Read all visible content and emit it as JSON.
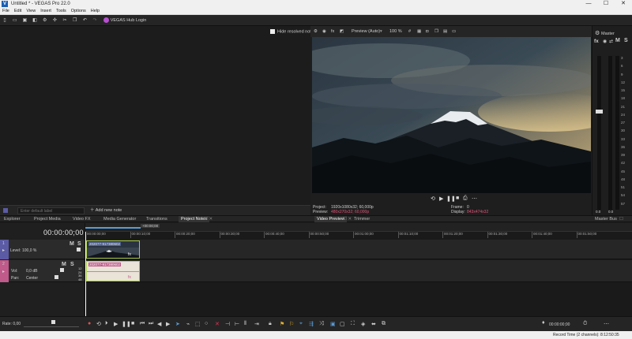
{
  "window": {
    "title": "Untitled * - VEGAS Pro 22.0",
    "app_icon_letter": "V",
    "minimize": "—",
    "maximize": "☐",
    "close": "✕"
  },
  "menu": [
    "File",
    "Edit",
    "View",
    "Insert",
    "Tools",
    "Options",
    "Help"
  ],
  "toolbar": {
    "hub_login": "VEGAS Hub Login"
  },
  "notes": {
    "hide_resolved_label": "Hide resolved notes",
    "default_label_placeholder": "Enter default label",
    "add_new_note": "Add new note"
  },
  "tabs": {
    "left": [
      "Explorer",
      "Project Media",
      "Video FX",
      "Media Generator",
      "Transitions",
      "Project Notes"
    ],
    "preview": [
      "Video Preview",
      "Trimmer"
    ],
    "master": "Master Bus"
  },
  "preview": {
    "mode": "Preview (Auto)",
    "zoom": "100 %",
    "project_label": "Project:",
    "project_value": "1920x1080x32; 60,000p",
    "preview_label": "Preview:",
    "preview_value": "480x270x32; 60,000p",
    "frame_label": "Frame:",
    "frame_value": "0",
    "display_label": "Display:",
    "display_value": "843x474x32"
  },
  "master": {
    "title": "Master",
    "fx": "fx",
    "m": "M",
    "s": "S",
    "scale": [
      "3",
      "6",
      "9",
      "12",
      "15",
      "18",
      "21",
      "24",
      "27",
      "30",
      "33",
      "36",
      "39",
      "42",
      "45",
      "48",
      "51",
      "54",
      "57"
    ],
    "left_value": "0.0",
    "right_value": "0.0"
  },
  "timeline": {
    "timecode": "00:00:00;00",
    "cursor_time": "00:00:00;00",
    "end_marker": "+00:00;00",
    "ruler": [
      "00:00:00;00",
      "00:00:10;00",
      "00:00:20;00",
      "00:00:30;00",
      "00:00:40;00",
      "00:00:50;00",
      "00:01:00;00",
      "00:01:10;00",
      "00:01:20;00",
      "00:01:30;00",
      "00:01:40;00",
      "00:01:50;00"
    ],
    "video_track": {
      "number": "1",
      "level_label": "Level:",
      "level_value": "100,0 %",
      "m": "M",
      "s": "S",
      "clip_name": "202077-917380602"
    },
    "audio_track": {
      "number": "2",
      "vol_label": "Vol:",
      "vol_value": "0,0 dB",
      "pan_label": "Pan:",
      "pan_value": "Center",
      "m": "M",
      "s": "S",
      "clip_name": "202077-917380602",
      "meter_scale": [
        "12",
        "24",
        "36",
        "48"
      ]
    }
  },
  "bottom": {
    "rate_label": "Rate: 0,00",
    "timecode_right": "00:00:00;00"
  },
  "status": {
    "record_time": "Record Time (2 channels): 8:12:50:35"
  },
  "colors": {
    "accent": "#1a5fb4",
    "video_track": "#5b5ba5",
    "audio_track": "#c05a8a",
    "clip_border": "#a7c94a",
    "preview_value": "#e0557a"
  }
}
